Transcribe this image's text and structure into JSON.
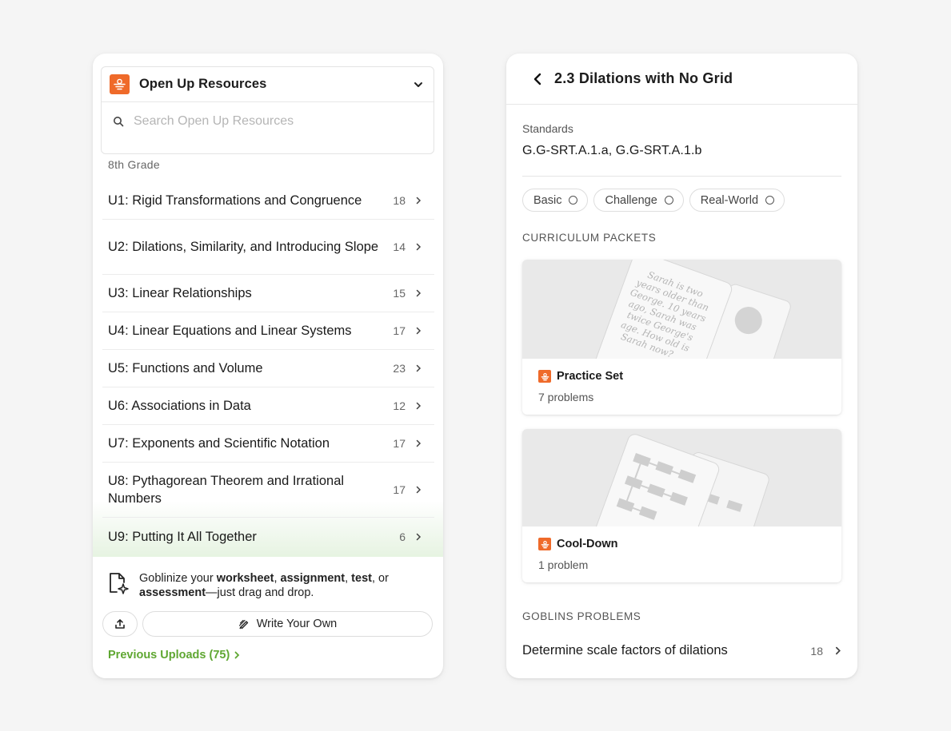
{
  "left_panel": {
    "selector": {
      "title": "Open Up Resources",
      "search_placeholder": "Search Open Up Resources"
    },
    "grade": "8th Grade",
    "units": [
      {
        "label": "U1: Rigid Transformations and Congruence",
        "count": "18"
      },
      {
        "label": "U2: Dilations, Similarity, and Introducing Slope",
        "count": "14"
      },
      {
        "label": "U3: Linear Relationships",
        "count": "15"
      },
      {
        "label": "U4: Linear Equations and Linear Systems",
        "count": "17"
      },
      {
        "label": "U5: Functions and Volume",
        "count": "23"
      },
      {
        "label": "U6: Associations in Data",
        "count": "12"
      },
      {
        "label": "U7: Exponents and Scientific Notation",
        "count": "17"
      },
      {
        "label": "U8: Pythagorean Theorem and Irrational Numbers",
        "count": "17"
      },
      {
        "label": "U9: Putting It All Together",
        "count": "6"
      }
    ],
    "upload": {
      "text_1": "Goblinize your ",
      "bold_1": "worksheet",
      "text_2": ", ",
      "bold_2": "assignment",
      "text_3": ", ",
      "bold_3": "test",
      "text_4": ", or ",
      "bold_4": "assessment",
      "text_5": "—just drag and drop.",
      "write_label": "Write Your Own",
      "previous_label": "Previous Uploads (75)"
    }
  },
  "right_panel": {
    "title": "2.3 Dilations with No Grid",
    "standards_label": "Standards",
    "standards_value": "G.G-SRT.A.1.a, G.G-SRT.A.1.b",
    "chips": [
      "Basic",
      "Challenge",
      "Real-World"
    ],
    "curriculum_heading": "CURRICULUM PACKETS",
    "packets": [
      {
        "title": "Practice Set",
        "sub": "7 problems",
        "preview_lines": [
          "Sarah is two",
          "years older than",
          "George. 10 years",
          "ago, Sarah was",
          "twice George's",
          "age. How old is",
          "Sarah now?"
        ]
      },
      {
        "title": "Cool-Down",
        "sub": "1 problem"
      }
    ],
    "goblins_heading": "GOBLINS PROBLEMS",
    "goblins": [
      {
        "label": "Determine scale factors of dilations",
        "count": "18"
      }
    ]
  },
  "colors": {
    "brand_orange": "#ef6a2a",
    "link_green": "#5fa732"
  }
}
